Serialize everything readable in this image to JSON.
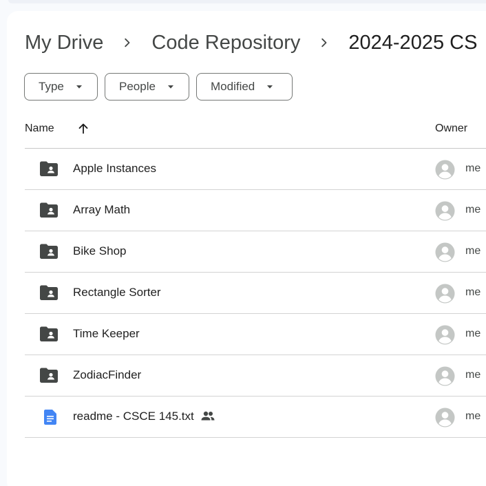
{
  "breadcrumb": [
    {
      "label": "My Drive"
    },
    {
      "label": "Code Repository"
    },
    {
      "label": "2024-2025 CS"
    }
  ],
  "filters": {
    "type_label": "Type",
    "people_label": "People",
    "modified_label": "Modified"
  },
  "table": {
    "col_name": "Name",
    "col_owner": "Owner",
    "sort": "name-ascending"
  },
  "files": [
    {
      "name": "Apple Instances",
      "kind": "shared-folder",
      "owner": "me"
    },
    {
      "name": "Array Math",
      "kind": "shared-folder",
      "owner": "me"
    },
    {
      "name": "Bike Shop",
      "kind": "shared-folder",
      "owner": "me"
    },
    {
      "name": "Rectangle Sorter",
      "kind": "shared-folder",
      "owner": "me"
    },
    {
      "name": "Time Keeper",
      "kind": "shared-folder",
      "owner": "me"
    },
    {
      "name": "ZodiacFinder",
      "kind": "shared-folder",
      "owner": "me"
    },
    {
      "name": "readme - CSCE 145.txt",
      "kind": "doc",
      "shared": true,
      "owner": "me"
    }
  ],
  "colors": {
    "folder": "#444746",
    "doc": "#4285f4",
    "avatar": "#c4c7c5"
  }
}
